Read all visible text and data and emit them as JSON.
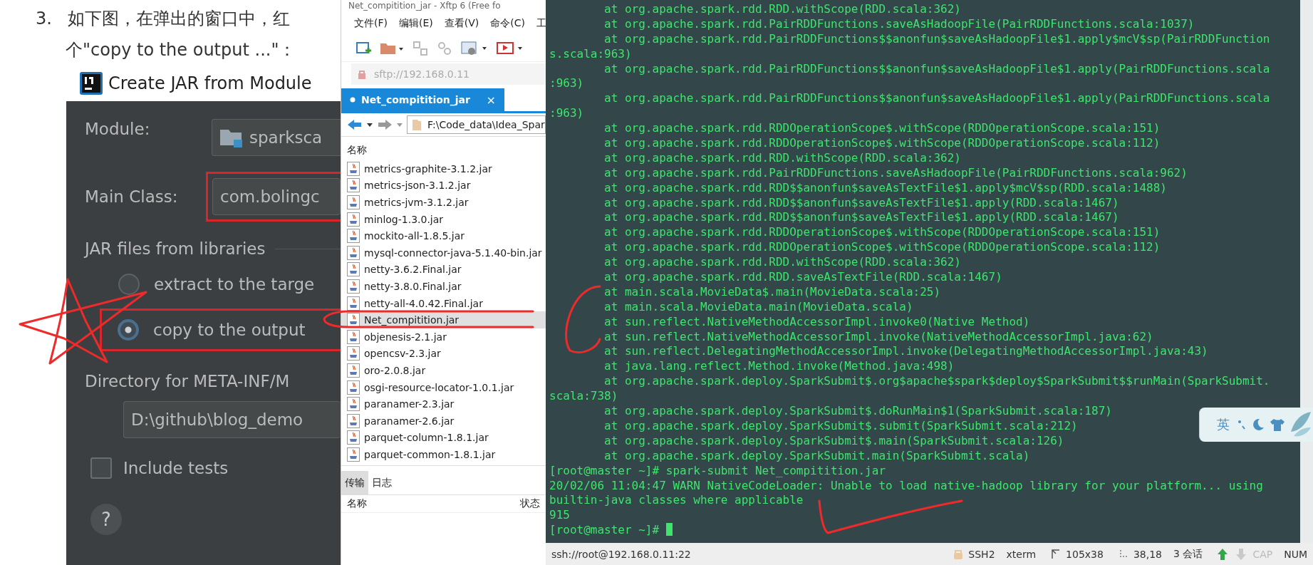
{
  "article": {
    "step_number": "3.",
    "line_1": "如下图，在弹出的窗口中，红",
    "line_2": "个\"copy to the output ...\"："
  },
  "dialog": {
    "title": "Create JAR from Module",
    "module_label": "Module:",
    "module_value": "sparksca",
    "main_class_label": "Main Class:",
    "main_class_value": "com.bolingc",
    "main_class_highlighted": true,
    "section": "JAR files from libraries",
    "options": [
      {
        "label": "extract to the targe",
        "selected": false,
        "highlighted": false
      },
      {
        "label": "copy to the output",
        "selected": true,
        "highlighted": true
      }
    ],
    "directory_label": "Directory for META-INF/M",
    "directory_value": "D:\\github\\blog_demo",
    "include_tests": {
      "label": "Include tests",
      "checked": false
    },
    "help": "?"
  },
  "xftp": {
    "title": "Net_compitition_jar - Xftp 6 (Free fo",
    "menu": [
      "文件(F)",
      "编辑(E)",
      "查看(V)",
      "命令(C)",
      "工"
    ],
    "address": "sftp://192.168.0.11",
    "tab": {
      "label": "Net_compitition_jar",
      "close": "×"
    },
    "path": "F:\\Code_data\\Idea_Spar",
    "column": "名称",
    "files": [
      {
        "name": "metrics-graphite-3.1.2.jar",
        "selected": false
      },
      {
        "name": "metrics-json-3.1.2.jar",
        "selected": false
      },
      {
        "name": "metrics-jvm-3.1.2.jar",
        "selected": false
      },
      {
        "name": "minlog-1.3.0.jar",
        "selected": false
      },
      {
        "name": "mockito-all-1.8.5.jar",
        "selected": false
      },
      {
        "name": "mysql-connector-java-5.1.40-bin.jar",
        "selected": false
      },
      {
        "name": "netty-3.6.2.Final.jar",
        "selected": false
      },
      {
        "name": "netty-3.8.0.Final.jar",
        "selected": false
      },
      {
        "name": "netty-all-4.0.42.Final.jar",
        "selected": false
      },
      {
        "name": "Net_compitition.jar",
        "selected": true
      },
      {
        "name": "objenesis-2.1.jar",
        "selected": false
      },
      {
        "name": "opencsv-2.3.jar",
        "selected": false
      },
      {
        "name": "oro-2.0.8.jar",
        "selected": false
      },
      {
        "name": "osgi-resource-locator-1.0.1.jar",
        "selected": false
      },
      {
        "name": "paranamer-2.3.jar",
        "selected": false
      },
      {
        "name": "paranamer-2.6.jar",
        "selected": false
      },
      {
        "name": "parquet-column-1.8.1.jar",
        "selected": false
      },
      {
        "name": "parquet-common-1.8.1.jar",
        "selected": false
      }
    ],
    "bottom_tabs": [
      {
        "label": "传输",
        "selected": true
      },
      {
        "label": "日志",
        "selected": false
      }
    ],
    "transfer_columns": [
      "名称",
      "状态"
    ]
  },
  "terminal": {
    "lines": [
      "\tat org.apache.spark.rdd.RDD.withScope(RDD.scala:362)",
      "\tat org.apache.spark.rdd.PairRDDFunctions.saveAsHadoopFile(PairRDDFunctions.scala:1037)",
      "\tat org.apache.spark.rdd.PairRDDFunctions$$anonfun$saveAsHadoopFile$1.apply$mcV$sp(PairRDDFunction",
      "s.scala:963)",
      "\tat org.apache.spark.rdd.PairRDDFunctions$$anonfun$saveAsHadoopFile$1.apply(PairRDDFunctions.scala",
      ":963)",
      "\tat org.apache.spark.rdd.PairRDDFunctions$$anonfun$saveAsHadoopFile$1.apply(PairRDDFunctions.scala",
      ":963)",
      "\tat org.apache.spark.rdd.RDDOperationScope$.withScope(RDDOperationScope.scala:151)",
      "\tat org.apache.spark.rdd.RDDOperationScope$.withScope(RDDOperationScope.scala:112)",
      "\tat org.apache.spark.rdd.RDD.withScope(RDD.scala:362)",
      "\tat org.apache.spark.rdd.PairRDDFunctions.saveAsHadoopFile(PairRDDFunctions.scala:962)",
      "\tat org.apache.spark.rdd.RDD$$anonfun$saveAsTextFile$1.apply$mcV$sp(RDD.scala:1488)",
      "\tat org.apache.spark.rdd.RDD$$anonfun$saveAsTextFile$1.apply(RDD.scala:1467)",
      "\tat org.apache.spark.rdd.RDD$$anonfun$saveAsTextFile$1.apply(RDD.scala:1467)",
      "\tat org.apache.spark.rdd.RDDOperationScope$.withScope(RDDOperationScope.scala:151)",
      "\tat org.apache.spark.rdd.RDDOperationScope$.withScope(RDDOperationScope.scala:112)",
      "\tat org.apache.spark.rdd.RDD.withScope(RDD.scala:362)",
      "\tat org.apache.spark.rdd.RDD.saveAsTextFile(RDD.scala:1467)",
      "\tat main.scala.MovieData$.main(MovieData.scala:25)",
      "\tat main.scala.MovieData.main(MovieData.scala)",
      "\tat sun.reflect.NativeMethodAccessorImpl.invoke0(Native Method)",
      "\tat sun.reflect.NativeMethodAccessorImpl.invoke(NativeMethodAccessorImpl.java:62)",
      "\tat sun.reflect.DelegatingMethodAccessorImpl.invoke(DelegatingMethodAccessorImpl.java:43)",
      "\tat java.lang.reflect.Method.invoke(Method.java:498)",
      "\tat org.apache.spark.deploy.SparkSubmit$.org$apache$spark$deploy$SparkSubmit$$runMain(SparkSubmit.",
      "scala:738)",
      "\tat org.apache.spark.deploy.SparkSubmit$.doRunMain$1(SparkSubmit.scala:187)",
      "\tat org.apache.spark.deploy.SparkSubmit$.submit(SparkSubmit.scala:212)",
      "\tat org.apache.spark.deploy.SparkSubmit$.main(SparkSubmit.scala:126)",
      "\tat org.apache.spark.deploy.SparkSubmit.main(SparkSubmit.scala)",
      "[root@master ~]# spark-submit Net_compitition.jar",
      "20/02/06 11:04:47 WARN NativeCodeLoader: Unable to load native-hadoop library for your platform... using",
      "builtin-java classes where applicable",
      "915",
      "[root@master ~]# "
    ],
    "cursor_visible": true
  },
  "status_bar": {
    "address": "ssh://root@192.168.0.11:22",
    "items": [
      {
        "text": "SSH2",
        "kind": "protocol"
      },
      {
        "text": "xterm",
        "kind": "terminal"
      },
      {
        "text": "105x38",
        "kind": "size"
      },
      {
        "text": "38,18",
        "kind": "position"
      },
      {
        "text": "3 会话",
        "kind": "sessions"
      }
    ],
    "indicators": [
      {
        "label": "CAP",
        "on": false
      },
      {
        "label": "NUM",
        "on": true
      }
    ]
  },
  "ime": {
    "mode": "英"
  }
}
